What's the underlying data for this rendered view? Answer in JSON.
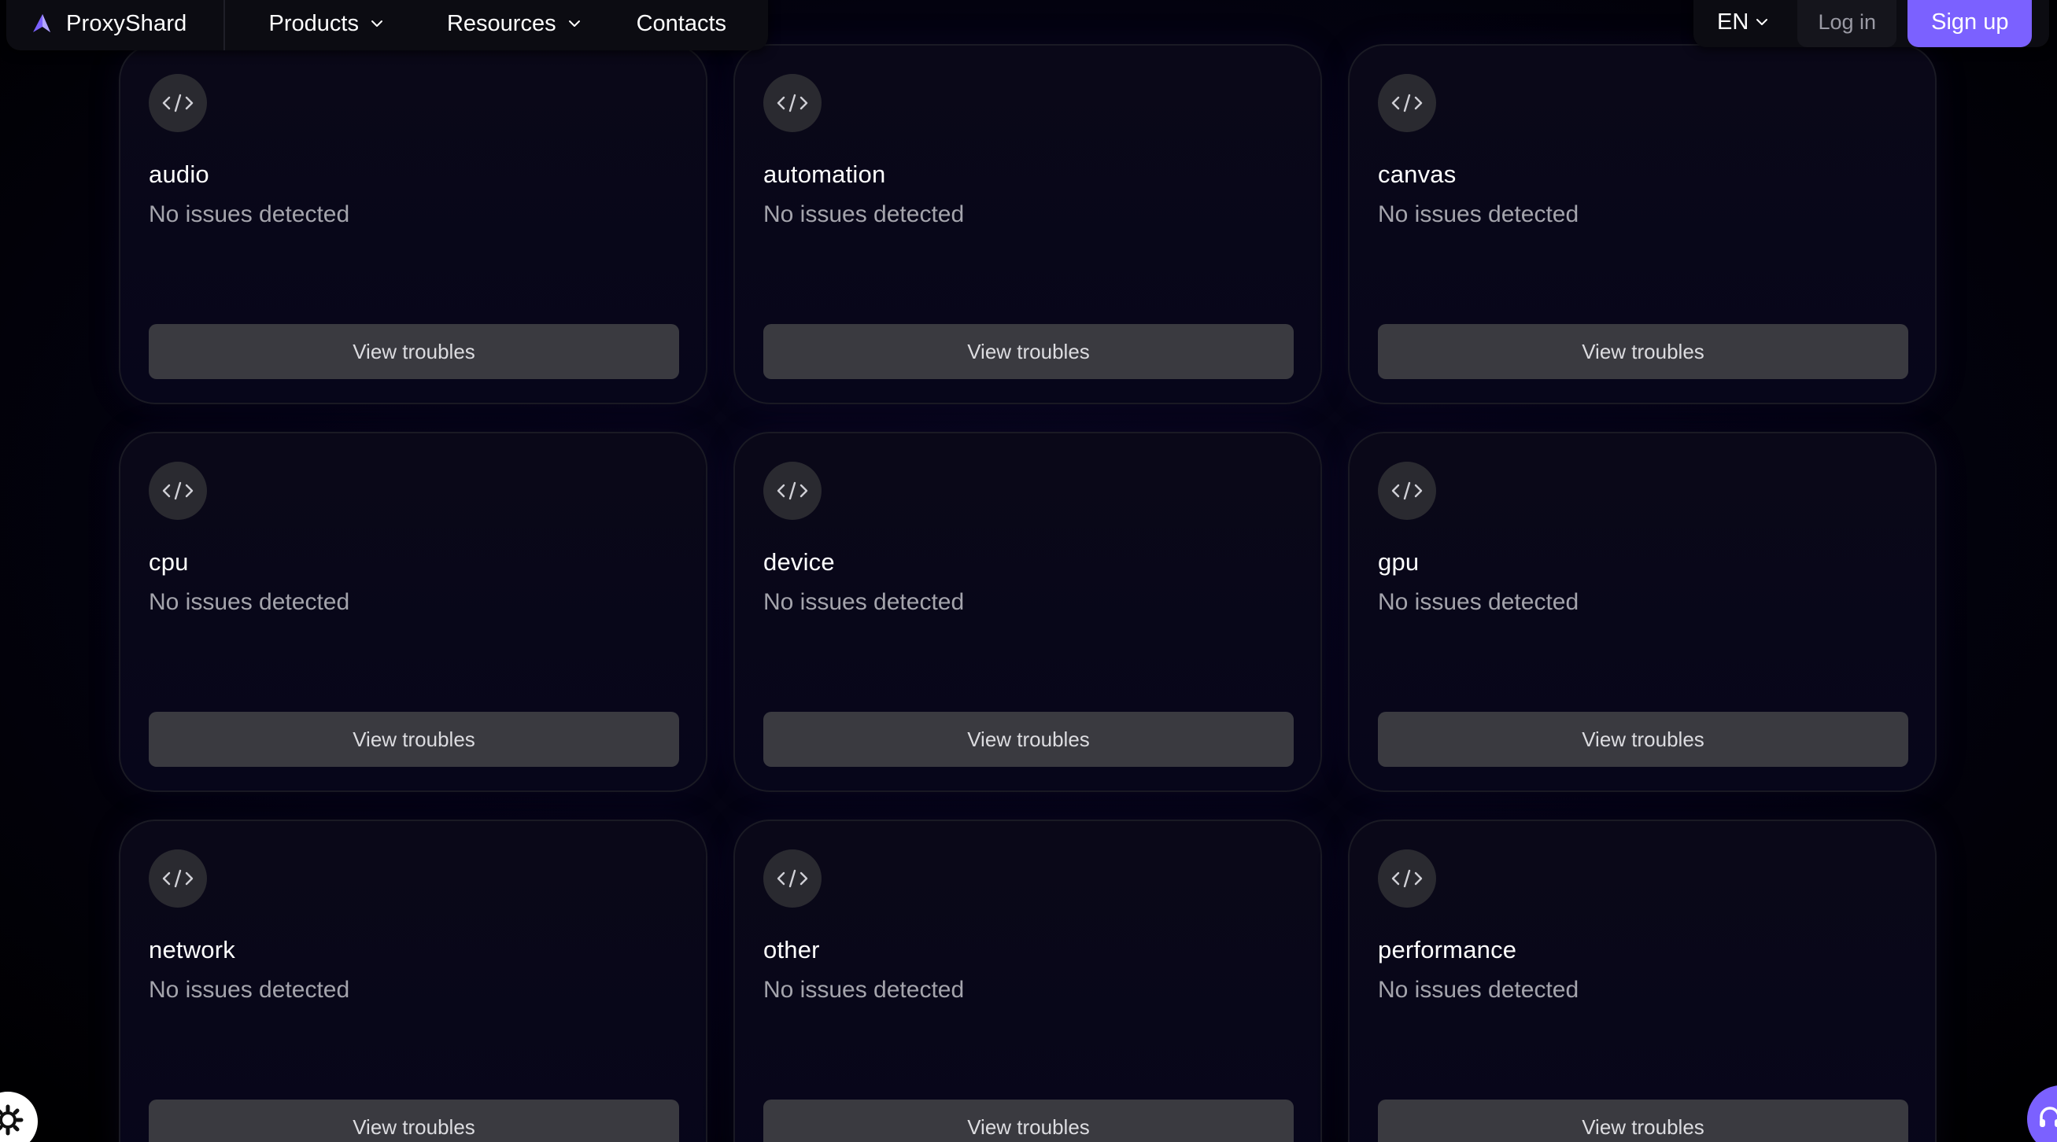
{
  "header": {
    "brand_name": "ProxyShard",
    "nav": [
      {
        "label": "Products"
      },
      {
        "label": "Resources"
      },
      {
        "label": "Contacts"
      }
    ],
    "language": "EN",
    "login_label": "Log in",
    "signup_label": "Sign up"
  },
  "cards": [
    {
      "title": "audio",
      "status": "No issues detected",
      "button_label": "View troubles"
    },
    {
      "title": "automation",
      "status": "No issues detected",
      "button_label": "View troubles"
    },
    {
      "title": "canvas",
      "status": "No issues detected",
      "button_label": "View troubles"
    },
    {
      "title": "cpu",
      "status": "No issues detected",
      "button_label": "View troubles"
    },
    {
      "title": "device",
      "status": "No issues detected",
      "button_label": "View troubles"
    },
    {
      "title": "gpu",
      "status": "No issues detected",
      "button_label": "View troubles"
    },
    {
      "title": "network",
      "status": "No issues detected",
      "button_label": "View troubles"
    },
    {
      "title": "other",
      "status": "No issues detected",
      "button_label": "View troubles"
    },
    {
      "title": "performance",
      "status": "No issues detected",
      "button_label": "View troubles"
    }
  ],
  "colors": {
    "accent": "#7b61ff",
    "background": "#000000",
    "card_background": "#0a0818",
    "button_background": "#3a3a40",
    "status_text": "#a4a4ac"
  },
  "icons": {
    "brand": "proxyshard-logo-icon",
    "card": "code-icon",
    "chevron": "chevron-down-icon",
    "left_widget": "cookie-settings-icon",
    "right_widget": "support-chat-icon"
  }
}
